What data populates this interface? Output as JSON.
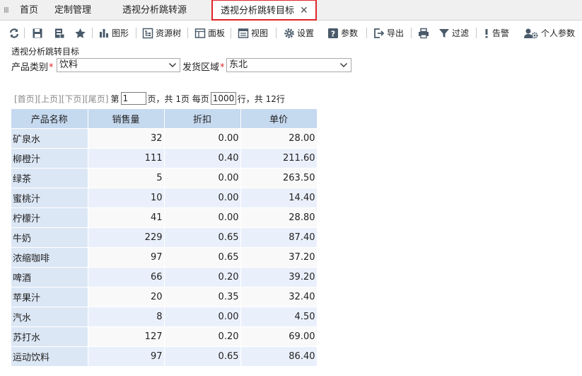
{
  "tabs": {
    "handle": "III",
    "items": [
      {
        "label": "首页"
      },
      {
        "label": "定制管理"
      },
      {
        "label": "透视分析跳转源"
      },
      {
        "label": "透视分析跳转目标"
      }
    ],
    "close_glyph": "✕"
  },
  "toolbar": {
    "graph": "图形",
    "resource_tree": "资源树",
    "panel": "面板",
    "view": "视图",
    "settings": "设置",
    "params": "参数",
    "export": "导出",
    "filter": "过滤",
    "alert": "告警",
    "personal_params": "个人参数"
  },
  "filters": {
    "title": "透视分析跳转目标",
    "category_label": "产品类别",
    "category_value": "饮料",
    "region_label": "发货区域",
    "region_value": "东北",
    "required_mark": "*"
  },
  "pager": {
    "first": "[首页]",
    "prev": "[上页]",
    "next": "[下页]",
    "last": "[尾页]",
    "page_prefix": "第",
    "page_number": "1",
    "page_suffix": "页，共 1页 每页",
    "rows_per_page": "1000",
    "rows_suffix": "行，共 12行"
  },
  "table": {
    "headers": [
      "产品名称",
      "销售量",
      "折扣",
      "单价"
    ],
    "rows": [
      [
        "矿泉水",
        "32",
        "0.00",
        "28.00"
      ],
      [
        "柳橙汁",
        "111",
        "0.40",
        "211.60"
      ],
      [
        "绿茶",
        "5",
        "0.00",
        "263.50"
      ],
      [
        "蜜桃汁",
        "10",
        "0.00",
        "14.40"
      ],
      [
        "柠檬汁",
        "41",
        "0.00",
        "28.80"
      ],
      [
        "牛奶",
        "229",
        "0.65",
        "87.40"
      ],
      [
        "浓缩咖啡",
        "97",
        "0.65",
        "37.20"
      ],
      [
        "啤酒",
        "66",
        "0.20",
        "39.20"
      ],
      [
        "苹果汁",
        "20",
        "0.35",
        "32.40"
      ],
      [
        "汽水",
        "8",
        "0.00",
        "4.50"
      ],
      [
        "苏打水",
        "127",
        "0.20",
        "69.00"
      ],
      [
        "运动饮料",
        "97",
        "0.65",
        "86.40"
      ]
    ]
  },
  "colors": {
    "active_tab_border": "#e0252a",
    "header_bg": "#c5d9ef",
    "name_col_bg": "#dce7f5",
    "alt_row_bg": "#eaf0fb"
  }
}
